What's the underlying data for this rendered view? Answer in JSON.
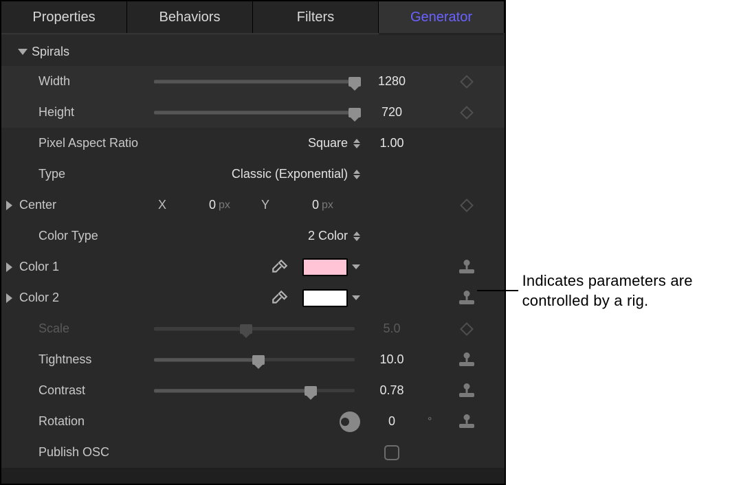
{
  "tabs": {
    "properties": "Properties",
    "behaviors": "Behaviors",
    "filters": "Filters",
    "generator": "Generator"
  },
  "group": {
    "title": "Spirals"
  },
  "rows": {
    "width": {
      "label": "Width",
      "value": "1280"
    },
    "height": {
      "label": "Height",
      "value": "720"
    },
    "par": {
      "label": "Pixel Aspect Ratio",
      "option": "Square",
      "value": "1.00"
    },
    "type": {
      "label": "Type",
      "option": "Classic (Exponential)"
    },
    "center": {
      "label": "Center",
      "x_label": "X",
      "x_value": "0",
      "x_unit": "px",
      "y_label": "Y",
      "y_value": "0",
      "y_unit": "px"
    },
    "ctype": {
      "label": "Color Type",
      "option": "2 Color"
    },
    "color1": {
      "label": "Color 1",
      "swatch": "#ffc4d6"
    },
    "color2": {
      "label": "Color 2",
      "swatch": "#ffffff"
    },
    "scale": {
      "label": "Scale",
      "value": "5.0"
    },
    "tight": {
      "label": "Tightness",
      "value": "10.0"
    },
    "contrast": {
      "label": "Contrast",
      "value": "0.78"
    },
    "rotation": {
      "label": "Rotation",
      "value": "0",
      "unit": "°"
    },
    "posc": {
      "label": "Publish OSC"
    }
  },
  "annotation": "Indicates parameters are controlled by a rig."
}
